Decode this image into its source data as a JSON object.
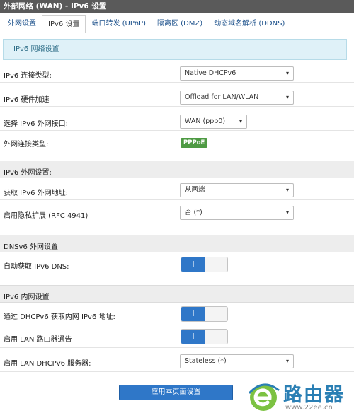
{
  "window": {
    "title": "外部网络 (WAN) - IPv6 设置"
  },
  "tabs": [
    {
      "label": "外网设置",
      "active": false
    },
    {
      "label": "IPv6 设置",
      "active": true
    },
    {
      "label": "端口转发 (UPnP)",
      "active": false
    },
    {
      "label": "隔离区 (DMZ)",
      "active": false
    },
    {
      "label": "动态域名解析 (DDNS)",
      "active": false
    }
  ],
  "info": {
    "text": "IPv6 网络设置"
  },
  "rows": {
    "conn_type": {
      "label": "IPv6 连接类型:",
      "value": "Native DHCPv6"
    },
    "hw_accel": {
      "label": "IPv6 硬件加速",
      "value": "Offload for LAN/WLAN"
    },
    "wan_iface": {
      "label": "选择 IPv6 外网接口:",
      "value": "WAN (ppp0)"
    },
    "ext_conn": {
      "label": "外网连接类型:",
      "badge": "PPPoE"
    }
  },
  "sections": {
    "ipv6_wan": "IPv6 外网设置:",
    "dnsv6": "DNSv6 外网设置",
    "ipv6_lan": "IPv6 内网设置"
  },
  "wan_rows": {
    "get_addr": {
      "label": "获取 IPv6 外网地址:",
      "value": "从两端"
    },
    "privacy": {
      "label": "启用隐私扩展 (RFC 4941)",
      "value": "否 (*)"
    }
  },
  "dns_rows": {
    "auto_dns": {
      "label": "自动获取 IPv6 DNS:",
      "toggle": "I"
    }
  },
  "lan_rows": {
    "dhcp_addr": {
      "label": "通过 DHCPv6 获取内网 IPv6 地址:",
      "toggle": "I"
    },
    "router_adv": {
      "label": "启用 LAN 路由器通告",
      "toggle": "I"
    },
    "dhcp_server": {
      "label": "启用 LAN DHCPv6 服务器:",
      "value": "Stateless (*)"
    }
  },
  "footer": {
    "apply_label": "应用本页面设置"
  },
  "watermark": {
    "text": "路由器",
    "url": "www.22ee.cn"
  },
  "icons": {
    "dropdown": "▾"
  },
  "colors": {
    "primary": "#2f77c8",
    "badge": "#4e9a43",
    "titlebar": "#5a5a5a"
  }
}
